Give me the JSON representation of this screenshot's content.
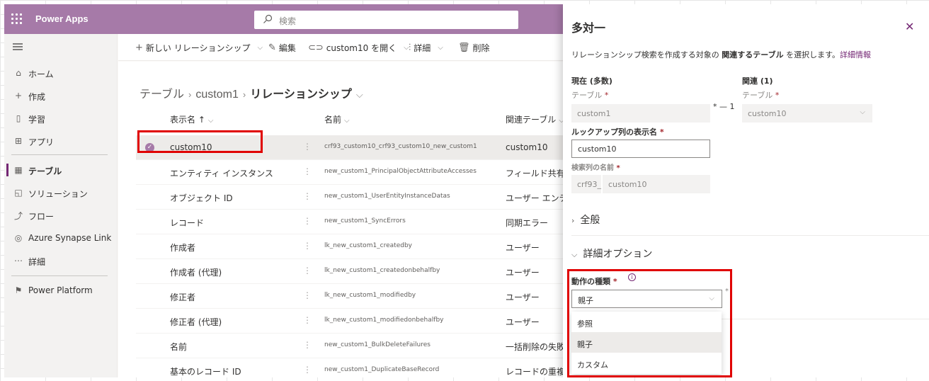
{
  "app": {
    "title": "Power Apps"
  },
  "search": {
    "placeholder": "検索"
  },
  "nav": {
    "items": [
      {
        "label": "ホーム",
        "icon": "home-icon"
      },
      {
        "label": "作成",
        "icon": "plus-icon"
      },
      {
        "label": "学習",
        "icon": "book-icon"
      },
      {
        "label": "アプリ",
        "icon": "apps-icon"
      },
      {
        "label": "テーブル",
        "icon": "table-icon"
      },
      {
        "label": "ソリューション",
        "icon": "solution-icon"
      },
      {
        "label": "フロー",
        "icon": "flow-icon"
      },
      {
        "label": "Azure Synapse Link",
        "icon": "synapse-icon"
      },
      {
        "label": "詳細",
        "icon": "more-icon"
      },
      {
        "label": "Power Platform",
        "icon": "power-platform-icon"
      }
    ]
  },
  "toolbar": {
    "new_relationship": "新しい リレーションシップ",
    "edit": "編集",
    "open": "custom10 を開く",
    "details": "詳細",
    "delete": "削除"
  },
  "breadcrumb": {
    "root": "テーブル",
    "table": "custom1",
    "current": "リレーションシップ"
  },
  "columns": {
    "display_name": "表示名 ↑",
    "name": "名前",
    "related_table": "関連テーブル"
  },
  "rows": [
    {
      "display": "custom10",
      "name": "crf93_custom10_crf93_custom10_new_custom1",
      "related": "custom10"
    },
    {
      "display": "エンティティ インスタンス",
      "name": "new_custom1_PrincipalObjectAttributeAccesses",
      "related": "フィールド共有"
    },
    {
      "display": "オブジェクト ID",
      "name": "new_custom1_UserEntityInstanceDatas",
      "related": "ユーザー エンティ"
    },
    {
      "display": "レコード",
      "name": "new_custom1_SyncErrors",
      "related": "同期エラー"
    },
    {
      "display": "作成者",
      "name": "lk_new_custom1_createdby",
      "related": "ユーザー"
    },
    {
      "display": "作成者 (代理)",
      "name": "lk_new_custom1_createdonbehalfby",
      "related": "ユーザー"
    },
    {
      "display": "修正者",
      "name": "lk_new_custom1_modifiedby",
      "related": "ユーザー"
    },
    {
      "display": "修正者 (代理)",
      "name": "lk_new_custom1_modifiedonbehalfby",
      "related": "ユーザー"
    },
    {
      "display": "名前",
      "name": "new_custom1_BulkDeleteFailures",
      "related": "一括削除の失敗"
    },
    {
      "display": "基本のレコード ID",
      "name": "new_custom1_DuplicateBaseRecord",
      "related": "レコードの重複"
    }
  ],
  "panel": {
    "title": "多対一",
    "desc_pre": "リレーションシップ検索を作成する対象の ",
    "desc_bold": "関連するテーブル",
    "desc_post": " を選択します。",
    "desc_link": "詳細情報",
    "current_header": "現在 (多数)",
    "related_header": "関連 (1)",
    "table_label": "テーブル",
    "current_table": "custom1",
    "related_table": "custom10",
    "cardinality": "* — 1",
    "lookup_label": "ルックアップ列の表示名",
    "lookup_value": "custom10",
    "search_col_label": "検索列の名前",
    "search_prefix": "crf93_",
    "search_value": "custom10",
    "general": "全般",
    "advanced": "詳細オプション",
    "behavior_label": "動作の種類",
    "behavior_value": "親子",
    "required_mark": "*",
    "options": [
      "参照",
      "親子",
      "カスタム"
    ]
  }
}
